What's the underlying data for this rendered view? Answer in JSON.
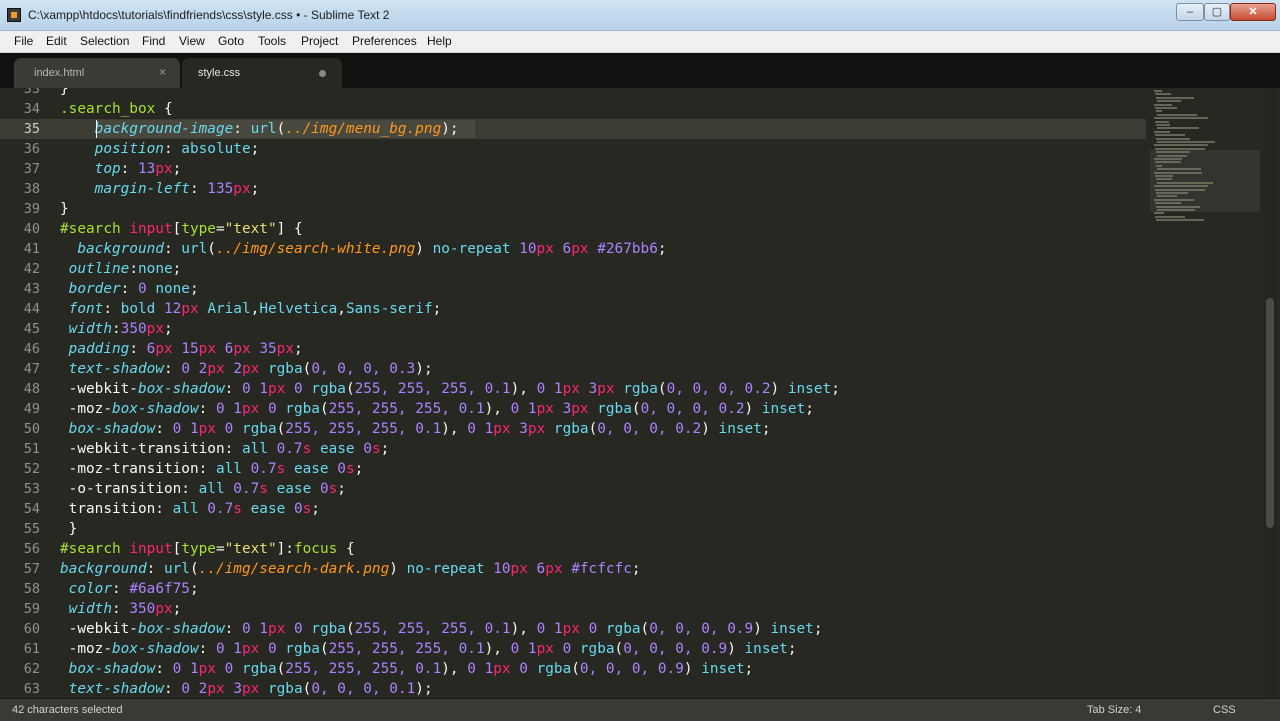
{
  "window": {
    "title": "C:\\xampp\\htdocs\\tutorials\\findfriends\\css\\style.css • - Sublime Text 2",
    "minimize": "–",
    "maximize": "▢",
    "close": "✕"
  },
  "menu": [
    "File",
    "Edit",
    "Selection",
    "Find",
    "View",
    "Goto",
    "Tools",
    "Project",
    "Preferences",
    "Help"
  ],
  "tabs": [
    {
      "label": "index.html",
      "close": "×",
      "active": false
    },
    {
      "label": "style.css",
      "active": true
    }
  ],
  "editor": {
    "theme_colors": {
      "background": "#272822",
      "string": "#e6db74",
      "property": "#66d9ef",
      "number": "#ae81ff",
      "keyword": "#f92672",
      "selector": "#a6e22e"
    },
    "line_numbers": [
      "33",
      "34",
      "35",
      "36",
      "37",
      "38",
      "39",
      "40",
      "41",
      "42",
      "43",
      "44",
      "45",
      "46",
      "47",
      "48",
      "49",
      "50",
      "51",
      "52",
      "53",
      "54",
      "55",
      "56",
      "57",
      "58",
      "59",
      "60",
      "61",
      "62",
      "63"
    ],
    "current_line": "35"
  },
  "status": {
    "selection": "42 characters selected",
    "tab_size": "Tab Size: 4",
    "syntax": "CSS"
  }
}
